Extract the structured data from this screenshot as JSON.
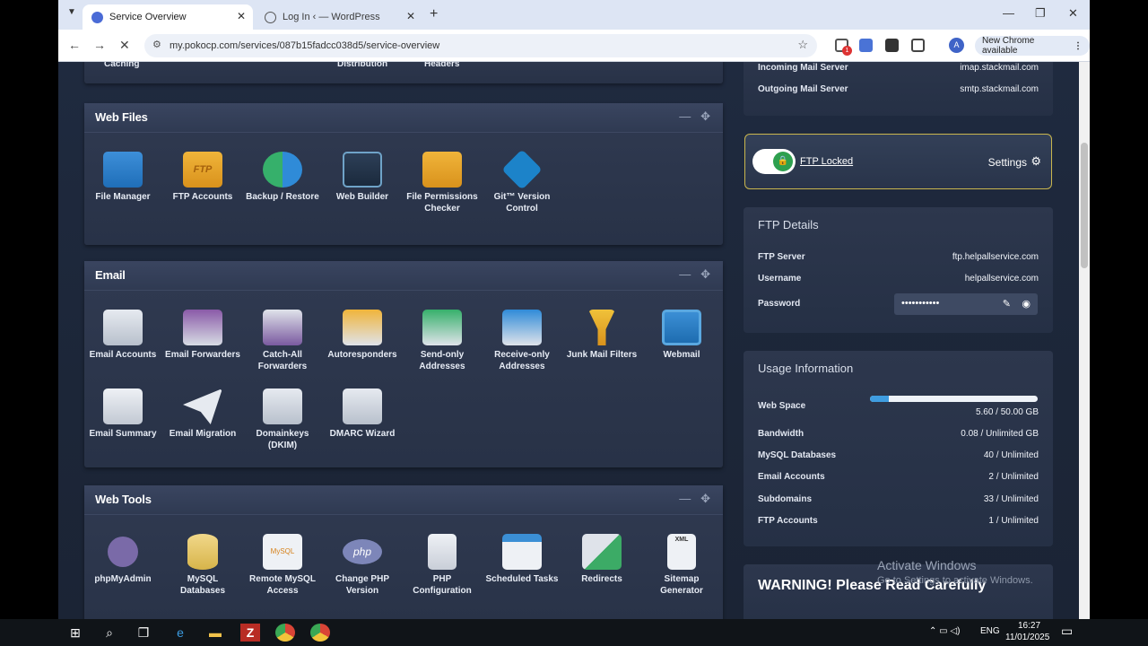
{
  "browser": {
    "tabs": [
      {
        "title": "Service Overview"
      },
      {
        "title": "Log In ‹ — WordPress"
      }
    ],
    "url": "my.pokocp.com/services/087b15fadcc038d5/service-overview",
    "new_chrome": "New Chrome available",
    "avatar_letter": "A",
    "notif_badge": "1"
  },
  "top_partial": {
    "items": [
      "Caching",
      "Distribution",
      "Headers"
    ]
  },
  "web_files": {
    "title": "Web Files",
    "items": [
      {
        "label": "File Manager",
        "icon": "folder-icon"
      },
      {
        "label": "FTP Accounts",
        "icon": "ftp-folder-icon",
        "icon_text": "FTP"
      },
      {
        "label": "Backup / Restore",
        "icon": "backup-icon"
      },
      {
        "label": "Web Builder",
        "icon": "web-builder-icon"
      },
      {
        "label": "File Permissions Checker",
        "icon": "permissions-folder-icon"
      },
      {
        "label": "Git™ Version Control",
        "icon": "git-icon"
      }
    ]
  },
  "email": {
    "title": "Email",
    "items": [
      {
        "label": "Email Accounts",
        "icon": "email-accounts-icon"
      },
      {
        "label": "Email Forwarders",
        "icon": "email-forwarders-icon"
      },
      {
        "label": "Catch-All Forwarders",
        "icon": "catch-all-icon"
      },
      {
        "label": "Autoresponders",
        "icon": "autoresponder-icon"
      },
      {
        "label": "Send-only Addresses",
        "icon": "send-only-icon"
      },
      {
        "label": "Receive-only Addresses",
        "icon": "receive-only-icon"
      },
      {
        "label": "Junk Mail Filters",
        "icon": "junk-filter-icon"
      },
      {
        "label": "Webmail",
        "icon": "webmail-icon"
      },
      {
        "label": "Email Summary",
        "icon": "email-summary-icon"
      },
      {
        "label": "Email Migration",
        "icon": "paper-plane-icon"
      },
      {
        "label": "Domainkeys (DKIM)",
        "icon": "dkim-icon"
      },
      {
        "label": "DMARC Wizard",
        "icon": "dmarc-icon"
      }
    ]
  },
  "web_tools": {
    "title": "Web Tools",
    "items": [
      {
        "label": "phpMyAdmin",
        "icon": "phpmyadmin-icon"
      },
      {
        "label": "MySQL Databases",
        "icon": "database-icon"
      },
      {
        "label": "Remote MySQL Access",
        "icon": "remote-mysql-icon",
        "icon_text": "MySQL"
      },
      {
        "label": "Change PHP Version",
        "icon": "php-icon",
        "icon_text": "php"
      },
      {
        "label": "PHP Configuration",
        "icon": "php-config-icon"
      },
      {
        "label": "Scheduled Tasks",
        "icon": "calendar-icon"
      },
      {
        "label": "Redirects",
        "icon": "redirect-icon"
      },
      {
        "label": "Sitemap Generator",
        "icon": "sitemap-icon",
        "icon_text": "XML"
      }
    ]
  },
  "mail_servers": {
    "rows": [
      {
        "key": "Incoming Mail Server",
        "value": "imap.stackmail.com"
      },
      {
        "key": "Outgoing Mail Server",
        "value": "smtp.stackmail.com"
      }
    ]
  },
  "ftp_lock": {
    "label": "FTP Locked",
    "settings": "Settings"
  },
  "ftp_details": {
    "title": "FTP Details",
    "server_key": "FTP Server",
    "server_value": "ftp.helpallservice.com",
    "username_key": "Username",
    "username_value": "helpallservice.com",
    "password_key": "Password",
    "password_value": "•••••••••••"
  },
  "usage": {
    "title": "Usage Information",
    "web_space_key": "Web Space",
    "web_space_value": "5.60 / 50.00 GB",
    "web_space_fraction": 0.112,
    "rows": [
      {
        "key": "Bandwidth",
        "value": "0.08 / Unlimited GB"
      },
      {
        "key": "MySQL Databases",
        "value": "40 / Unlimited"
      },
      {
        "key": "Email Accounts",
        "value": "2 / Unlimited"
      },
      {
        "key": "Subdomains",
        "value": "33 / Unlimited"
      },
      {
        "key": "FTP Accounts",
        "value": "1 / Unlimited"
      }
    ]
  },
  "warning": {
    "title": "WARNING! Please Read Carefully"
  },
  "watermark": {
    "line1": "Activate Windows",
    "line2": "Go to Settings to activate Windows."
  },
  "taskbar": {
    "lang": "ENG",
    "time": "16:27",
    "date": "11/01/2025"
  },
  "colors": {
    "accent_gold": "#c9b64e",
    "toggle_green": "#2ea04f",
    "progress_blue": "#3f9de0",
    "panel_bg": "#2c364c"
  }
}
